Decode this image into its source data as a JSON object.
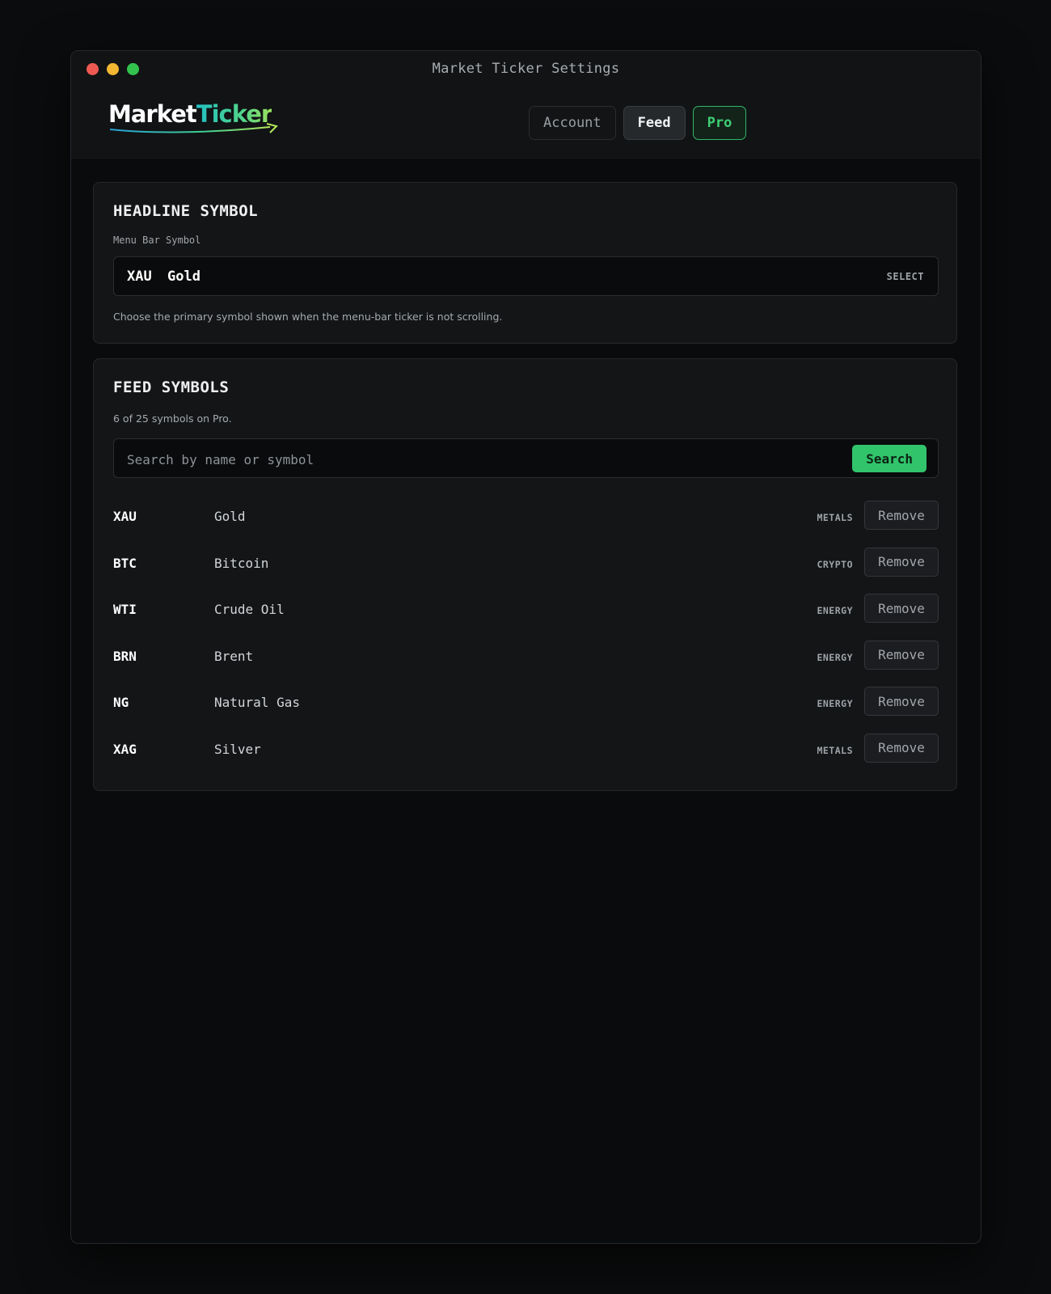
{
  "window": {
    "title": "Market Ticker Settings"
  },
  "logo": {
    "part1": "Market",
    "part2": "Ticker"
  },
  "nav": {
    "account": "Account",
    "feed": "Feed",
    "pro": "Pro"
  },
  "headline": {
    "title": "HEADLINE SYMBOL",
    "field_label": "Menu Bar Symbol",
    "selected_symbol": "XAU",
    "selected_name": "Gold",
    "select_hint": "SELECT",
    "help": "Choose the primary symbol shown when the menu-bar ticker is not scrolling."
  },
  "feed": {
    "title": "FEED SYMBOLS",
    "count_text": "6 of 25 symbols on Pro.",
    "search_placeholder": "Search by name or symbol",
    "search_button": "Search",
    "remove_label": "Remove",
    "symbols": [
      {
        "symbol": "XAU",
        "name": "Gold",
        "category": "METALS"
      },
      {
        "symbol": "BTC",
        "name": "Bitcoin",
        "category": "CRYPTO"
      },
      {
        "symbol": "WTI",
        "name": "Crude Oil",
        "category": "ENERGY"
      },
      {
        "symbol": "BRN",
        "name": "Brent",
        "category": "ENERGY"
      },
      {
        "symbol": "NG",
        "name": "Natural Gas",
        "category": "ENERGY"
      },
      {
        "symbol": "XAG",
        "name": "Silver",
        "category": "METALS"
      }
    ]
  },
  "colors": {
    "accent_green": "#31c46b",
    "window_bg": "#0a0b0c",
    "card_bg": "#131517"
  }
}
